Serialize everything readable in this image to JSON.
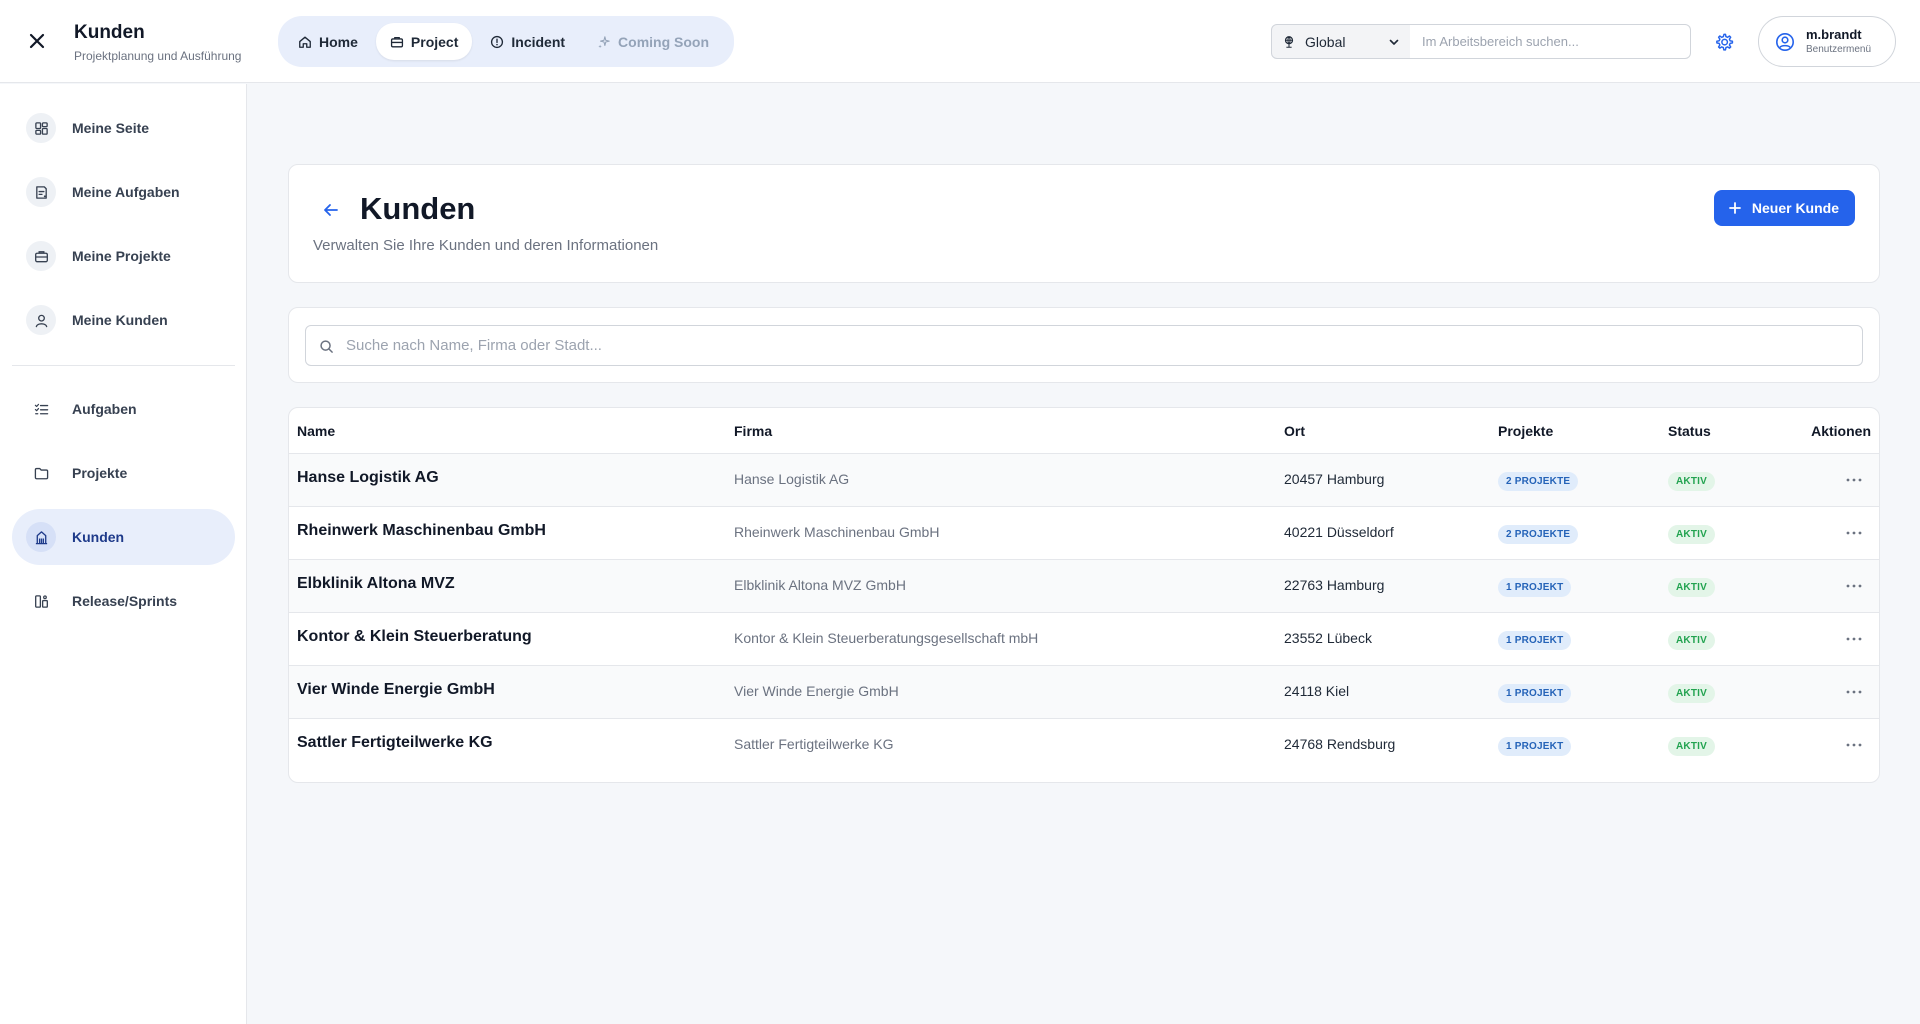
{
  "app": {
    "title": "Kunden",
    "subtitle": "Projektplanung und Ausführung"
  },
  "nav": {
    "items": [
      {
        "label": "Home",
        "icon": "home-icon"
      },
      {
        "label": "Project",
        "icon": "briefcase-icon",
        "active": true
      },
      {
        "label": "Incident",
        "icon": "alert-circle-icon"
      },
      {
        "label": "Coming Soon",
        "icon": "sparkle-icon",
        "muted": true
      }
    ]
  },
  "scope": {
    "label": "Global",
    "icon": "globe-pin-icon"
  },
  "workspace_search": {
    "placeholder": "Im Arbeitsbereich suchen..."
  },
  "user": {
    "name": "m.brandt",
    "menu_label": "Benutzermenü"
  },
  "sidebar": {
    "items": [
      {
        "label": "Meine Seite",
        "icon": "dashboard-icon"
      },
      {
        "label": "Meine Aufgaben",
        "icon": "task-list-icon"
      },
      {
        "label": "Meine Projekte",
        "icon": "briefcase-icon"
      },
      {
        "label": "Meine Kunden",
        "icon": "user-icon"
      },
      {
        "label": "Aufgaben",
        "icon": "checklist-icon"
      },
      {
        "label": "Projekte",
        "icon": "folder-icon"
      },
      {
        "label": "Kunden",
        "icon": "building-icon",
        "active": true
      },
      {
        "label": "Release/Sprints",
        "icon": "release-icon"
      }
    ]
  },
  "page": {
    "title": "Kunden",
    "description": "Verwalten Sie Ihre Kunden und deren Informationen",
    "new_button": "Neuer Kunde"
  },
  "search": {
    "placeholder": "Suche nach Name, Firma oder Stadt..."
  },
  "table": {
    "columns": [
      "Name",
      "Firma",
      "Ort",
      "Projekte",
      "Status",
      "Aktionen"
    ],
    "rows": [
      {
        "name": "Hanse Logistik AG",
        "firma": "Hanse Logistik AG",
        "ort": "20457 Hamburg",
        "projekte": "2 PROJEKTE",
        "status": "AKTIV"
      },
      {
        "name": "Rheinwerk Maschinenbau GmbH",
        "firma": "Rheinwerk Maschinenbau GmbH",
        "ort": "40221 Düsseldorf",
        "projekte": "2 PROJEKTE",
        "status": "AKTIV"
      },
      {
        "name": "Elbklinik Altona MVZ",
        "firma": "Elbklinik Altona MVZ GmbH",
        "ort": "22763 Hamburg",
        "projekte": "1 PROJEKT",
        "status": "AKTIV"
      },
      {
        "name": "Kontor & Klein Steuerberatung",
        "firma": "Kontor & Klein Steuerberatungsgesellschaft mbH",
        "ort": "23552 Lübeck",
        "projekte": "1 PROJEKT",
        "status": "AKTIV"
      },
      {
        "name": "Vier Winde Energie GmbH",
        "firma": "Vier Winde Energie GmbH",
        "ort": "24118 Kiel",
        "projekte": "1 PROJEKT",
        "status": "AKTIV"
      },
      {
        "name": "Sattler Fertigteilwerke KG",
        "firma": "Sattler Fertigteilwerke KG",
        "ort": "24768 Rendsburg",
        "projekte": "1 PROJEKT",
        "status": "AKTIV"
      }
    ]
  },
  "colors": {
    "accent": "#2563eb",
    "nav_bg": "#e8eefb",
    "badge_project": "#e0ecfb",
    "badge_status": "#e3f5e8"
  }
}
